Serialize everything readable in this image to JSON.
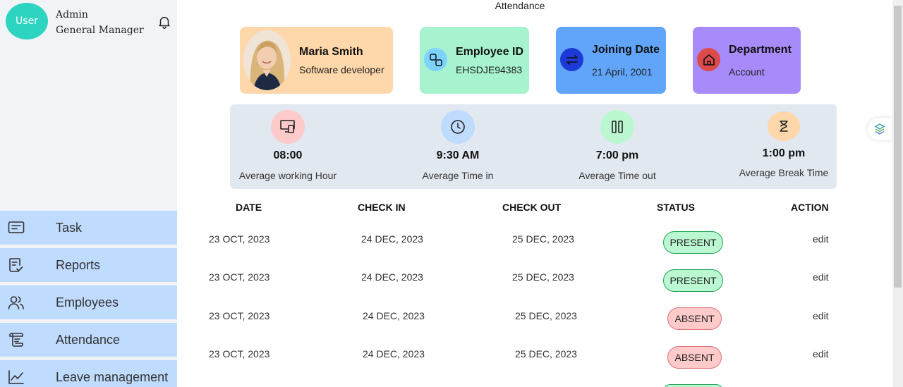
{
  "sidebar": {
    "avatar_text": "User",
    "role": "Admin",
    "title": "General Manager",
    "items": [
      {
        "label": "Task",
        "icon": "task-icon"
      },
      {
        "label": "Reports",
        "icon": "report-icon"
      },
      {
        "label": "Employees",
        "icon": "users-icon"
      },
      {
        "label": "Attendance",
        "icon": "attendance-icon"
      },
      {
        "label": "Leave management",
        "icon": "chart-line-icon"
      }
    ]
  },
  "header": {
    "title": "Attendance"
  },
  "cards": {
    "profile": {
      "name": "Maria Smith",
      "role": "Software developer"
    },
    "employee_id": {
      "title": "Employee ID",
      "value": "EHSDJE94383"
    },
    "joining": {
      "title": "Joining Date",
      "value": "21 April, 2001"
    },
    "department": {
      "title": "Department",
      "value": "Account"
    }
  },
  "stats": [
    {
      "value": "08:00",
      "label": "Average working Hour",
      "icon": "devices-icon",
      "color": "#fecaca"
    },
    {
      "value": "9:30 AM",
      "label": "Average Time in",
      "icon": "clock-icon",
      "color": "#bfdbfe"
    },
    {
      "value": "7:00 pm",
      "label": "Average Time out",
      "icon": "pause-icon",
      "color": "#bbf7d0"
    },
    {
      "value": "1:00 pm",
      "label": "Average Break Time",
      "icon": "hourglass-icon",
      "color": "#fed7aa"
    }
  ],
  "table": {
    "headers": {
      "date": "DATE",
      "check_in": "CHECK IN",
      "check_out": "CHECK OUT",
      "status": "STATUS",
      "action": "ACTION"
    },
    "rows": [
      {
        "date": "23 OCT, 2023",
        "check_in": "24 DEC, 2023",
        "check_out": "25 DEC, 2023",
        "status": "PRESENT",
        "action": "edit"
      },
      {
        "date": "23 OCT, 2023",
        "check_in": "24 DEC, 2023",
        "check_out": "25 DEC, 2023",
        "status": "PRESENT",
        "action": "edit"
      },
      {
        "date": "23 OCT, 2023",
        "check_in": "24 DEC, 2023",
        "check_out": "25 DEC, 2023",
        "status": "ABSENT",
        "action": "edit"
      },
      {
        "date": "23 OCT, 2023",
        "check_in": "24 DEC, 2023",
        "check_out": "25 DEC, 2023",
        "status": "ABSENT",
        "action": "edit"
      }
    ]
  },
  "colors": {
    "sidebar_bg": "#f1f3f6",
    "nav_bg": "#bfdbfe",
    "avatar": "#2dd4bf",
    "card_profile": "#fed7aa",
    "card_employee": "#a7f3d0",
    "card_joining": "#60a5fa",
    "card_department": "#a78bfa",
    "present": "#bbf7d0",
    "absent": "#fecaca"
  }
}
